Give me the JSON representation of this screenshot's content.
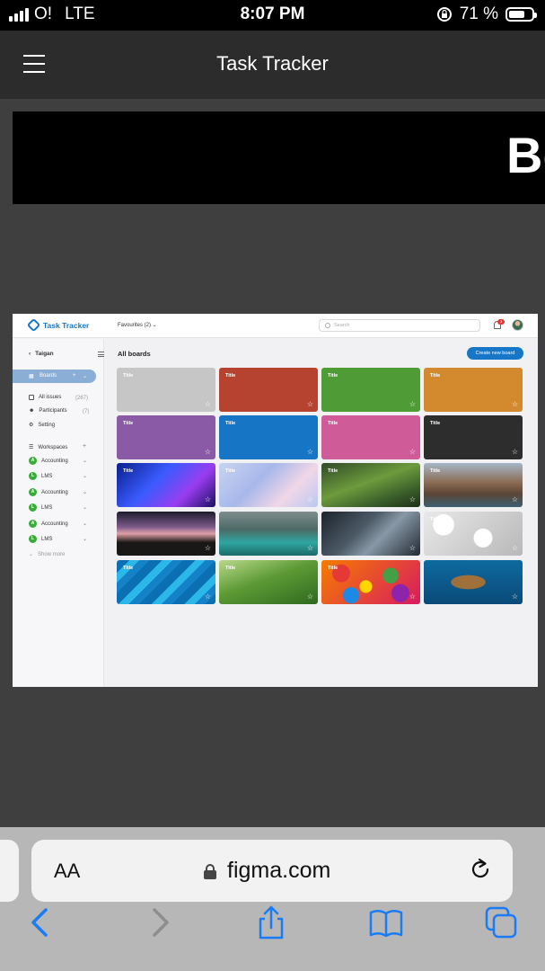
{
  "status_bar": {
    "carrier": "O!",
    "network": "LTE",
    "time": "8:07 PM",
    "battery": "71 %",
    "battery_level": 0.71
  },
  "prototype": {
    "title": "Task Tracker",
    "banner_text": "Bo"
  },
  "app": {
    "logo_text": "Task Tracker",
    "favourites_label": "Favourites (2)",
    "search_placeholder": "Search",
    "notification_count": "3",
    "sidebar": {
      "back_label": "Taigan",
      "boards_label": "Boards",
      "items": [
        {
          "label": "All issues",
          "count": "(267)"
        },
        {
          "label": "Participants",
          "count": "(7)"
        },
        {
          "label": "Setting",
          "count": ""
        }
      ],
      "workspaces_label": "Workspaces",
      "workspaces": [
        {
          "letter": "A",
          "label": "Accounting"
        },
        {
          "letter": "L",
          "label": "LMS"
        },
        {
          "letter": "A",
          "label": "Accounting"
        },
        {
          "letter": "L",
          "label": "LMS"
        },
        {
          "letter": "A",
          "label": "Accounting"
        },
        {
          "letter": "L",
          "label": "LMS"
        }
      ],
      "show_more": "Show more"
    },
    "main_title": "All boards",
    "create_button": "Create new board",
    "boards": [
      {
        "title": "Title",
        "bg": "#c6c6c6"
      },
      {
        "title": "Title",
        "bg": "#b5432f"
      },
      {
        "title": "Title",
        "bg": "#4f9b35"
      },
      {
        "title": "Title",
        "bg": "#d38a2e"
      },
      {
        "title": "Title",
        "bg": "#8a5aa6"
      },
      {
        "title": "Title",
        "bg": "#1675c4"
      },
      {
        "title": "Title",
        "bg": "#cf5b98"
      },
      {
        "title": "Title",
        "bg": "#2d2d2d"
      },
      {
        "title": "Title",
        "bg": "linear-gradient(135deg,#0a1f8f,#3b5bff 40%,#9a3cf0 70%,#1a0f5f)"
      },
      {
        "title": "Title",
        "bg": "linear-gradient(135deg,#c9d3f2,#a7b8ea 40%,#f1d6e8 70%,#b9c9f0)"
      },
      {
        "title": "Title",
        "bg": "linear-gradient(160deg,#2f4a26,#6d9b3d 45%,#3a5e2a 75%,#1f2e18)"
      },
      {
        "title": "Title",
        "bg": "linear-gradient(180deg,#a6b6c8,#8a6a52 45%,#5b4636 70%,#3d5f73)"
      },
      {
        "title": "",
        "bg": "linear-gradient(180deg,#1d1b2c,#7c5a8a 35%,#e0a0a8 50%,#1a1816 70%)"
      },
      {
        "title": "",
        "bg": "linear-gradient(180deg,#7d8e8c,#4d6966 40%,#2fa6a0 70%,#1c6b69)"
      },
      {
        "title": "",
        "bg": "linear-gradient(135deg,#1c232b,#4c5a66 40%,#8898a6 60%,#222a33)"
      },
      {
        "title": "Title",
        "bg": "radial-gradient(circle at 20% 30%,#fff 0 12%,transparent 13%),radial-gradient(circle at 60% 60%,#fff 0 14%,transparent 15%),linear-gradient(135deg,#e9e9e9,#b8b8b8)"
      },
      {
        "title": "Title",
        "bg": "repeating-linear-gradient(135deg,#0a6fb3 0 10px,#2bb8e8 10px 18px,#1582c8 18px 26px)"
      },
      {
        "title": "Title",
        "bg": "linear-gradient(160deg,#b9d98a,#5d9a35 45%,#2f6a1f)"
      },
      {
        "title": "Title",
        "bg": "radial-gradient(circle at 20% 30%,#e53935 0 10%,transparent 11%),radial-gradient(circle at 45% 60%,#ffd600 0 10%,transparent 11%),radial-gradient(circle at 70% 35%,#43a047 0 10%,transparent 11%),radial-gradient(circle at 80% 75%,#8e24aa 0 10%,transparent 11%),radial-gradient(circle at 30% 80%,#1e88e5 0 10%,transparent 11%),linear-gradient(135deg,#f57c00,#d81b60)"
      },
      {
        "title": "",
        "bg": "radial-gradient(ellipse at 45% 50%,#a0703a 0 22%,transparent 23%),linear-gradient(180deg,#0e6aa0,#0a4a78)"
      }
    ]
  },
  "safari": {
    "text_size_label": "AA",
    "url": "figma.com"
  }
}
